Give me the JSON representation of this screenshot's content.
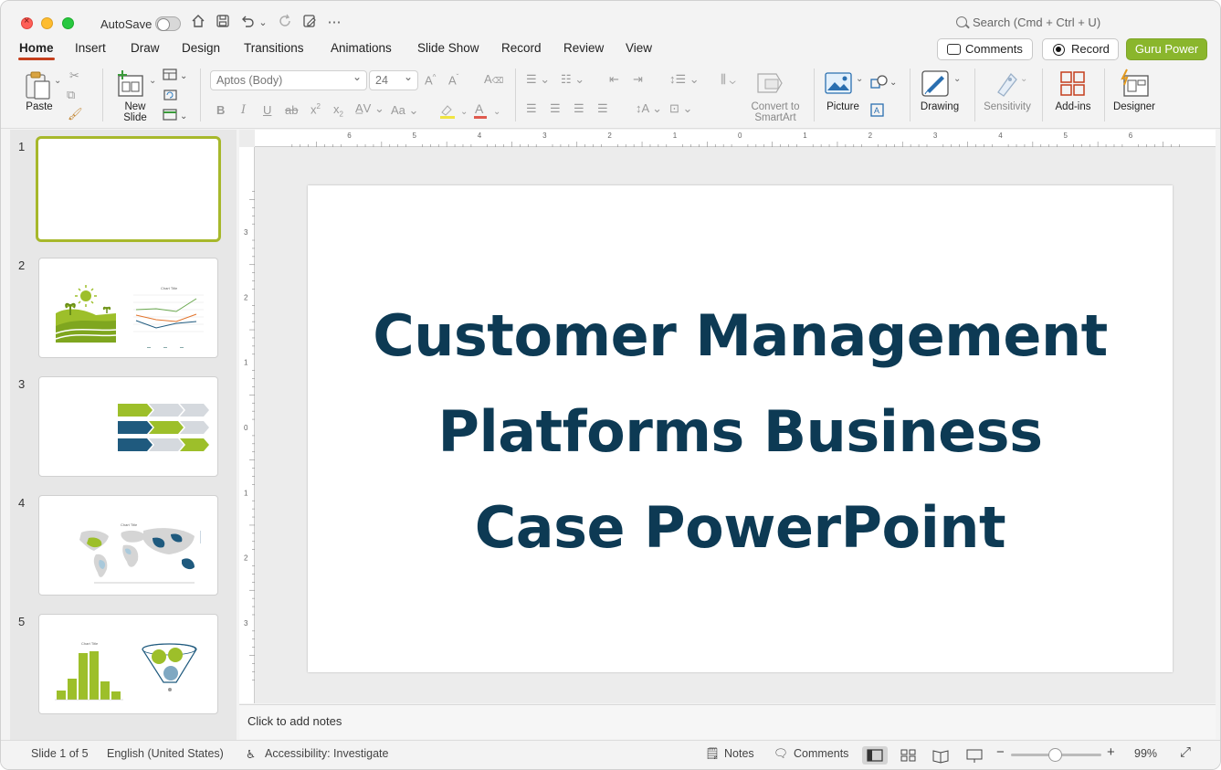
{
  "titlebar": {
    "autosave_label": "AutoSave",
    "search_placeholder": "Search (Cmd + Ctrl + U)"
  },
  "tabs": [
    "Home",
    "Insert",
    "Draw",
    "Design",
    "Transitions",
    "Animations",
    "Slide Show",
    "Record",
    "Review",
    "View"
  ],
  "active_tab": "Home",
  "header_buttons": {
    "comments": "Comments",
    "record": "Record",
    "guru": "Guru Power"
  },
  "ribbon": {
    "paste": "Paste",
    "new_slide": "New\nSlide",
    "new_slide_line1": "New",
    "new_slide_line2": "Slide",
    "font_name": "Aptos (Body)",
    "font_size": "24",
    "convert_smartart_line1": "Convert to",
    "convert_smartart_line2": "SmartArt",
    "picture": "Picture",
    "drawing": "Drawing",
    "sensitivity": "Sensitivity",
    "addins": "Add-ins",
    "designer": "Designer"
  },
  "slides": [
    {
      "number": "1"
    },
    {
      "number": "2",
      "chart_title": "Chart Title"
    },
    {
      "number": "3"
    },
    {
      "number": "4",
      "chart_title": "Chart Title"
    },
    {
      "number": "5",
      "chart_title": "Chart Title"
    }
  ],
  "current_slide": {
    "title_line1": "Customer Management",
    "title_line2": "Platforms Business",
    "title_line3": "Case PowerPoint"
  },
  "notes_placeholder": "Click to add notes",
  "status": {
    "slide_counter": "Slide 1 of 5",
    "language": "English (United States)",
    "accessibility": "Accessibility: Investigate",
    "notes": "Notes",
    "comments": "Comments",
    "zoom": "99%"
  },
  "colors": {
    "accent_red": "#c43e1c",
    "guru_green": "#8ab62c",
    "title_navy": "#0d3a54",
    "thumb_green": "#9dbf2a",
    "thumb_blue": "#1f5a7e"
  }
}
